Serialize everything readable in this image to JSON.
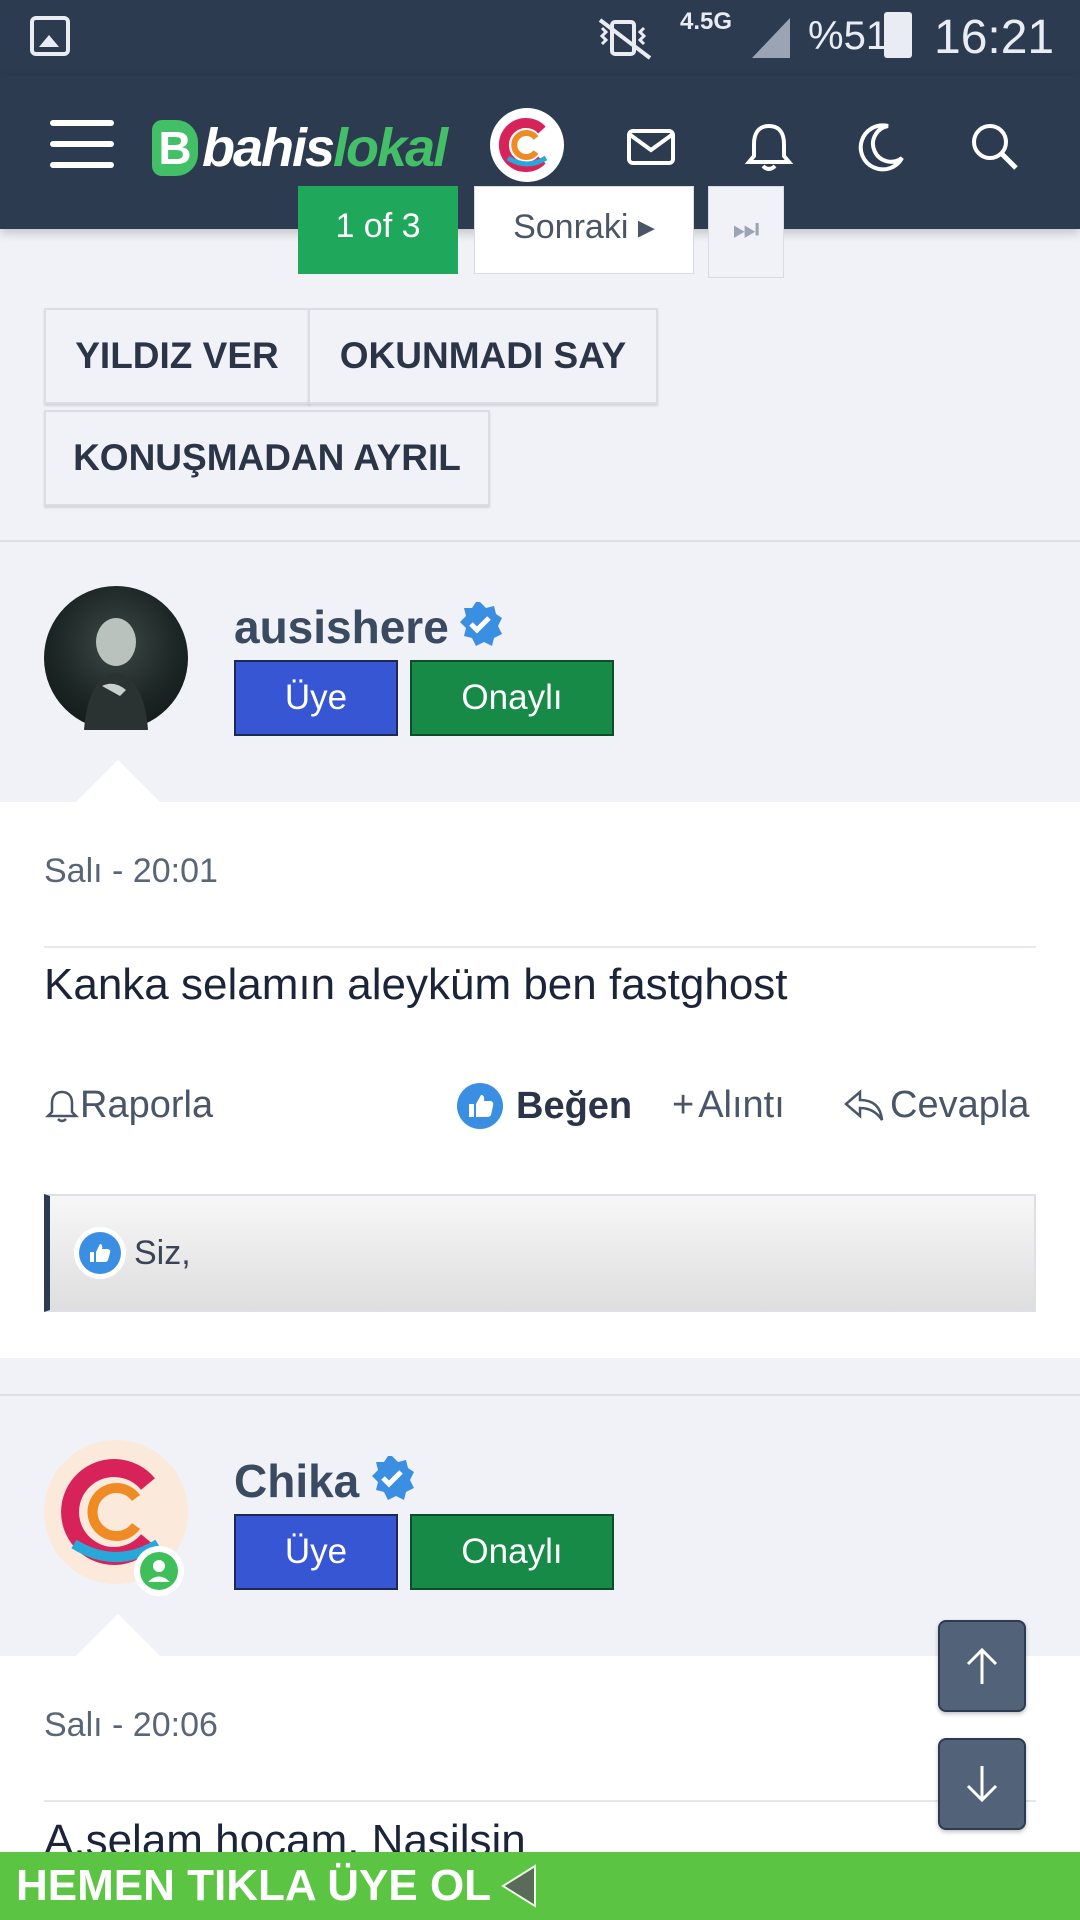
{
  "status_bar": {
    "network": "4.5G",
    "battery": "%51",
    "time": "16:21"
  },
  "header": {
    "logo_part1": "bahis",
    "logo_part2": "lokal",
    "icons": [
      "menu-icon",
      "mail-icon",
      "bell-icon",
      "moon-icon",
      "search-icon"
    ]
  },
  "pagination": {
    "current": "1 of 3",
    "next_label": "Sonraki",
    "last_symbol": "⏭"
  },
  "actions": {
    "star": "YILDIZ VER",
    "mark_unread": "OKUNMADI SAY",
    "leave": "KONUŞMADAN AYRIL"
  },
  "posts": [
    {
      "username": "ausishere",
      "badge_member": "Üye",
      "badge_approved": "Onaylı",
      "time": "Salı - 20:01",
      "text": "Kanka selamın aleyküm ben fastghost",
      "report": "Raporla",
      "like": "Beğen",
      "quote": "Alıntı",
      "reply": "Cevapla",
      "likes_text": "Siz,"
    },
    {
      "username": "Chika",
      "badge_member": "Üye",
      "badge_approved": "Onaylı",
      "time": "Salı - 20:06",
      "text": "A.selam hocam. Nasilsin"
    }
  ],
  "banner": {
    "text": "HEMEN TIKLA ÜYE OL"
  },
  "colors": {
    "header_bg": "#2d3b51",
    "brand_green": "#43c067",
    "member_badge": "#3756d4",
    "approved_badge": "#178a47",
    "banner_green": "#5cc443"
  }
}
